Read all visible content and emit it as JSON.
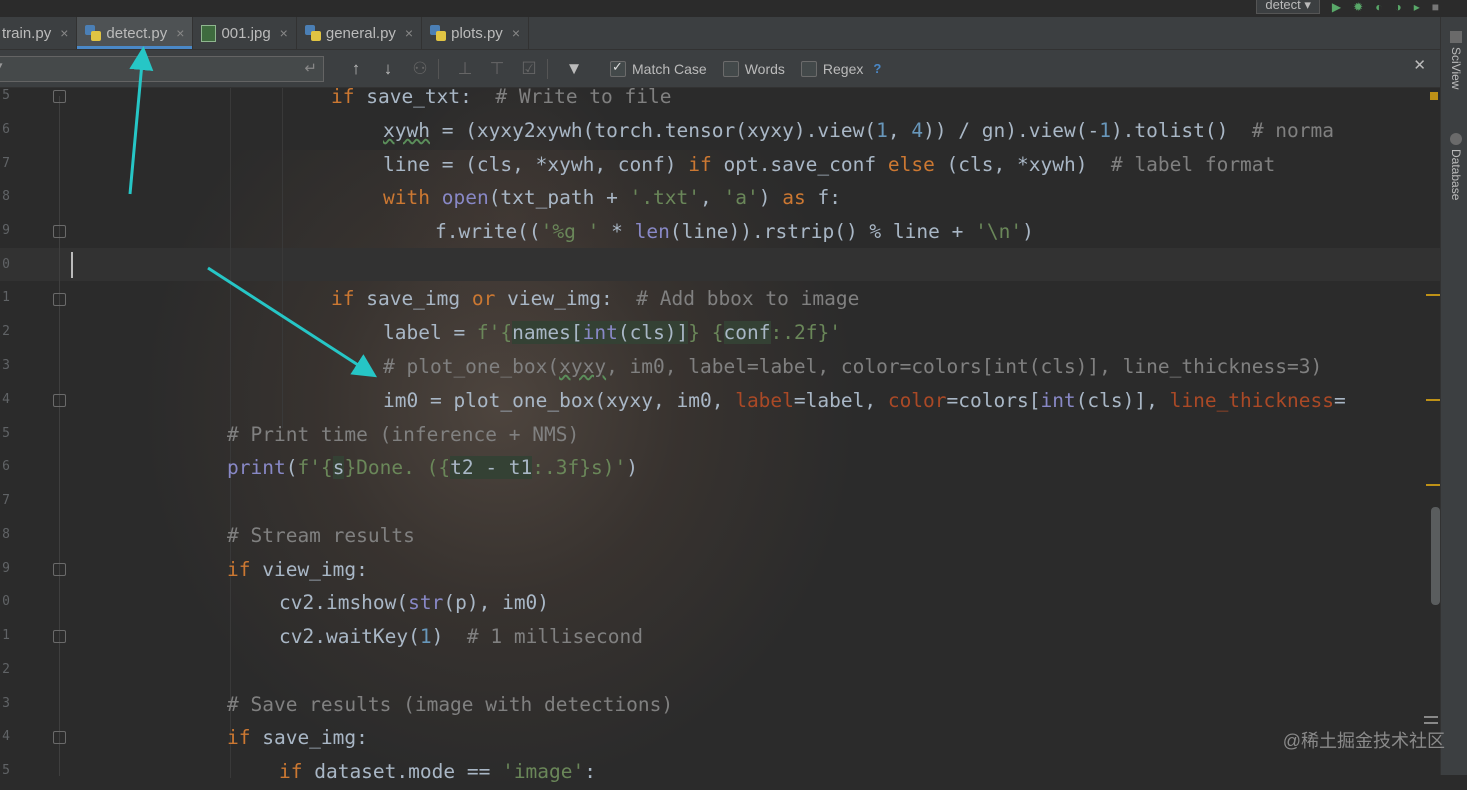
{
  "tabs": [
    {
      "label": "train.py",
      "icon": "python-file-icon",
      "active": false
    },
    {
      "label": "detect.py",
      "icon": "python-file-icon",
      "active": true
    },
    {
      "label": "001.jpg",
      "icon": "image-file-icon",
      "active": false
    },
    {
      "label": "general.py",
      "icon": "python-file-icon",
      "active": false
    },
    {
      "label": "plots.py",
      "icon": "python-file-icon",
      "active": false
    }
  ],
  "run_config": "detect",
  "search": {
    "value": "",
    "options": {
      "match_case": "Match Case",
      "words": "Words",
      "regex": "Regex",
      "help": "?"
    },
    "match_case_checked": true,
    "words_checked": false,
    "regex_checked": false
  },
  "line_numbers": [
    "5",
    "6",
    "7",
    "8",
    "9",
    "0",
    "1",
    "2",
    "3",
    "4",
    "5",
    "6",
    "7",
    "8",
    "9",
    "0",
    "1",
    "2",
    "3",
    "4",
    "5"
  ],
  "right_panel": {
    "sciview": "SciView",
    "database": "Database"
  },
  "watermark": "@稀土掘金技术社区",
  "colors": {
    "keyword": "#cc7832",
    "comment": "#808080",
    "string": "#6a8759",
    "number": "#6897bb",
    "builtin": "#8888c6",
    "param": "#aa4926",
    "accent": "#4a88c7",
    "arrow": "#26c6c6"
  }
}
